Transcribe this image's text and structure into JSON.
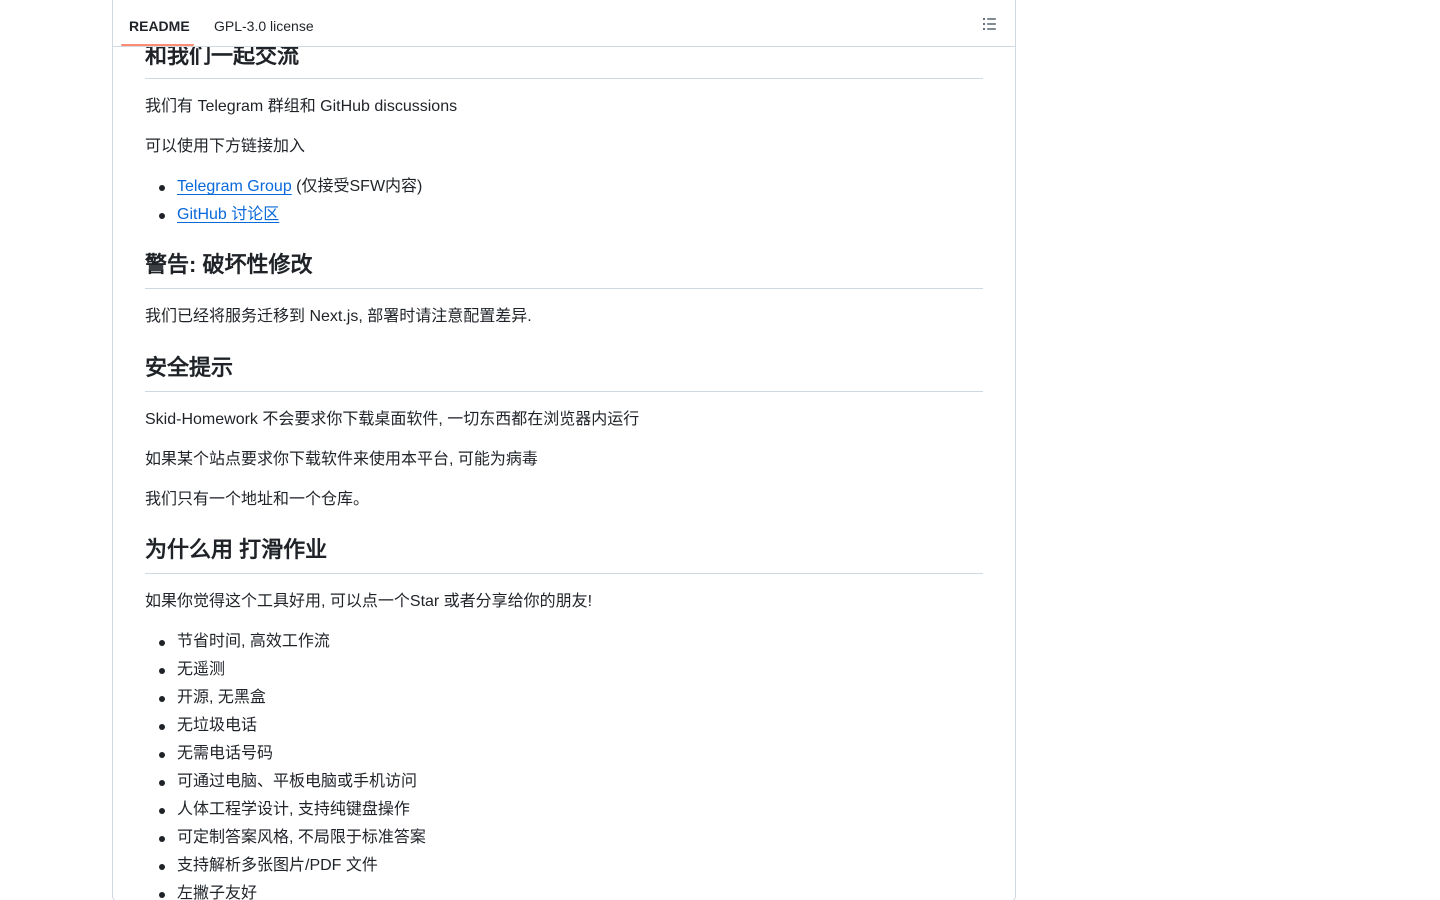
{
  "tabs": {
    "readme": "README",
    "license": "GPL-3.0 license"
  },
  "sections": {
    "community": {
      "heading": "和我们一起交流",
      "p1": "我们有 Telegram 群组和 GitHub discussions",
      "p2": "可以使用下方链接加入",
      "links": [
        {
          "link_text": "Telegram Group",
          "suffix": " (仅接受SFW内容)"
        },
        {
          "link_text": "GitHub 讨论区",
          "suffix": ""
        }
      ]
    },
    "warning": {
      "heading": "警告: 破坏性修改",
      "p1": "我们已经将服务迁移到 Next.js, 部署时请注意配置差异."
    },
    "security": {
      "heading": "安全提示",
      "p1": "Skid-Homework 不会要求你下载桌面软件, 一切东西都在浏览器内运行",
      "p2": "如果某个站点要求你下载软件来使用本平台, 可能为病毒",
      "p3": "我们只有一个地址和一个仓库。"
    },
    "why": {
      "heading": "为什么用 打滑作业",
      "p1": "如果你觉得这个工具好用, 可以点一个Star 或者分享给你的朋友!",
      "features": [
        "节省时间, 高效工作流",
        "无遥测",
        "开源, 无黑盒",
        "无垃圾电话",
        "无需电话号码",
        "可通过电脑、平板电脑或手机访问",
        "人体工程学设计, 支持纯键盘操作",
        "可定制答案风格, 不局限于标准答案",
        "支持解析多张图片/PDF 文件",
        "左撇子友好"
      ]
    }
  },
  "colors": {
    "text": "#1f2328",
    "link": "#0969da",
    "border": "#d1d9e0",
    "tab_underline": "#fd8c73"
  }
}
